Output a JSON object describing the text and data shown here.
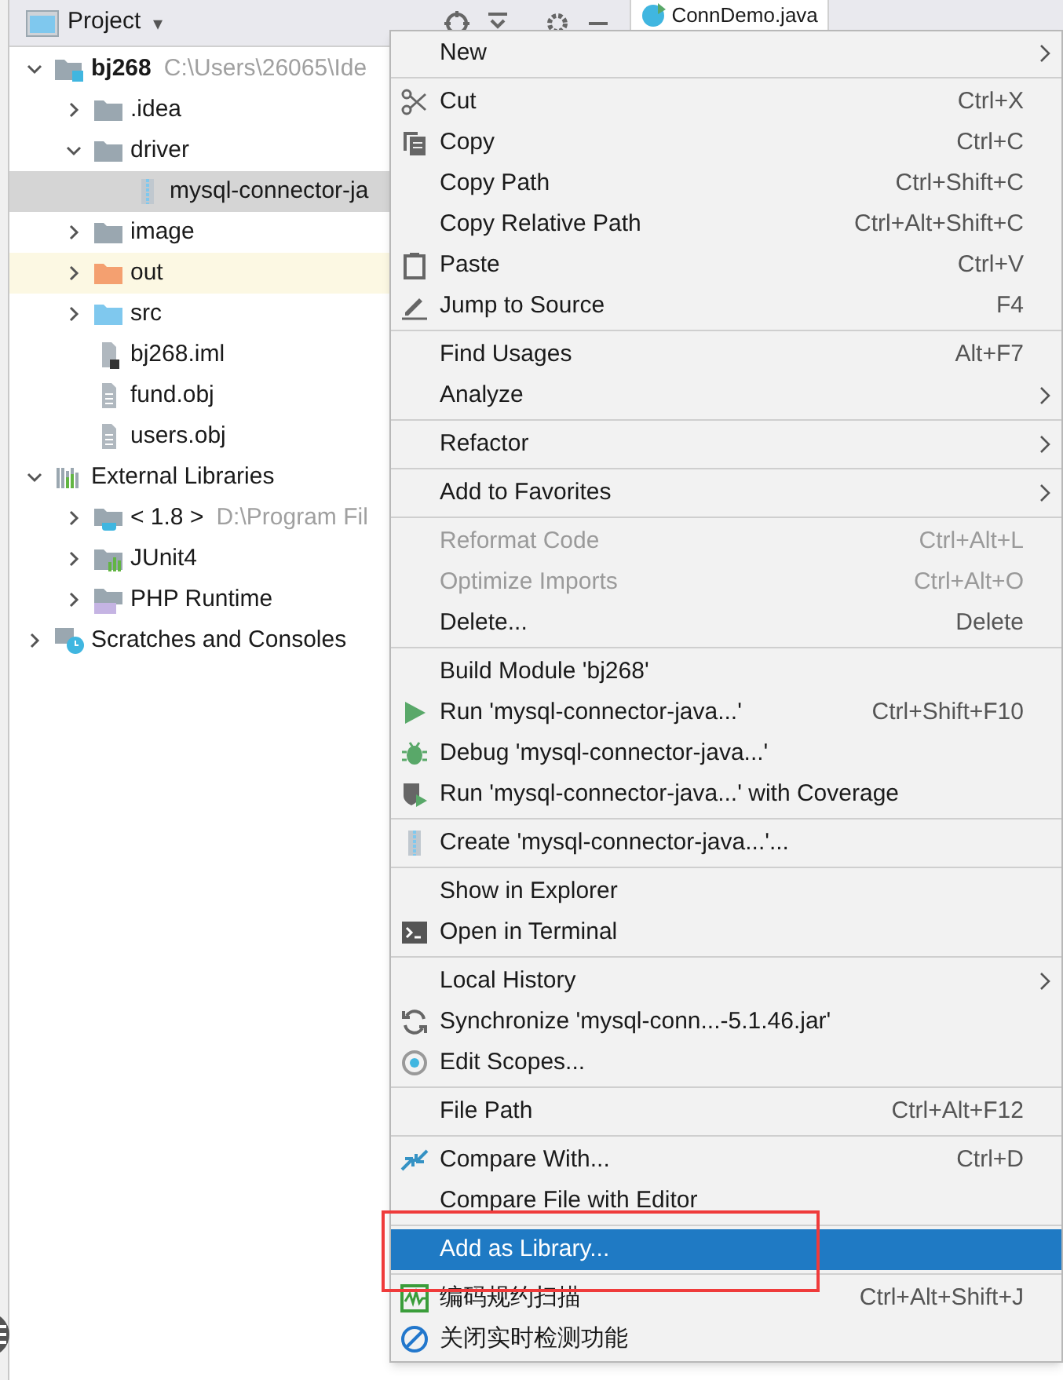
{
  "panel": {
    "title": "Project",
    "dropdown": "▾"
  },
  "editor_tab": {
    "label": "ConnDemo.java"
  },
  "tree": [
    {
      "label": "bj268",
      "detail": "C:\\Users\\26065\\Ide",
      "kind": "module",
      "expanded": true,
      "selected": false,
      "highlighted": false,
      "children": [
        {
          "label": ".idea",
          "kind": "folder",
          "expanded": false,
          "selected": false,
          "highlighted": false
        },
        {
          "label": "driver",
          "kind": "folder",
          "expanded": true,
          "selected": false,
          "highlighted": false,
          "children": [
            {
              "label": "mysql-connector-ja",
              "kind": "jar",
              "selected": true,
              "highlighted": false
            }
          ]
        },
        {
          "label": "image",
          "kind": "folder",
          "expanded": false,
          "selected": false,
          "highlighted": false
        },
        {
          "label": "out",
          "kind": "excluded",
          "expanded": false,
          "selected": false,
          "highlighted": true
        },
        {
          "label": "src",
          "kind": "source",
          "expanded": false,
          "selected": false,
          "highlighted": false
        },
        {
          "label": "bj268.iml",
          "kind": "iml",
          "selected": false,
          "highlighted": false
        },
        {
          "label": "fund.obj",
          "kind": "file",
          "selected": false,
          "highlighted": false
        },
        {
          "label": "users.obj",
          "kind": "file",
          "selected": false,
          "highlighted": false
        }
      ]
    },
    {
      "label": "External Libraries",
      "kind": "libraries",
      "expanded": true,
      "selected": false,
      "highlighted": false,
      "children": [
        {
          "label": "< 1.8 >",
          "detail": "D:\\Program Fil",
          "kind": "jdk",
          "expanded": false,
          "selected": false,
          "highlighted": false
        },
        {
          "label": "JUnit4",
          "kind": "library",
          "expanded": false,
          "selected": false,
          "highlighted": false
        },
        {
          "label": "PHP Runtime",
          "kind": "php",
          "expanded": false,
          "selected": false,
          "highlighted": false
        }
      ]
    },
    {
      "label": "Scratches and Consoles",
      "kind": "scratches",
      "expanded": false,
      "selected": false,
      "highlighted": false
    }
  ],
  "context_menu": [
    {
      "kind": "plain",
      "label": "New",
      "submenu": true,
      "disabled": false,
      "selected": false
    },
    {
      "kind": "separator"
    },
    {
      "kind": "cut",
      "label": "Cut",
      "shortcut": "Ctrl+X",
      "submenu": false,
      "disabled": false,
      "selected": false
    },
    {
      "kind": "copy",
      "label": "Copy",
      "shortcut": "Ctrl+C",
      "submenu": false,
      "disabled": false,
      "selected": false
    },
    {
      "kind": "plain",
      "label": "Copy Path",
      "shortcut": "Ctrl+Shift+C",
      "submenu": false,
      "disabled": false,
      "selected": false
    },
    {
      "kind": "plain",
      "label": "Copy Relative Path",
      "shortcut": "Ctrl+Alt+Shift+C",
      "submenu": false,
      "disabled": false,
      "selected": false
    },
    {
      "kind": "paste",
      "label": "Paste",
      "shortcut": "Ctrl+V",
      "submenu": false,
      "disabled": false,
      "selected": false
    },
    {
      "kind": "jump",
      "label": "Jump to Source",
      "shortcut": "F4",
      "submenu": false,
      "disabled": false,
      "selected": false
    },
    {
      "kind": "separator"
    },
    {
      "kind": "plain",
      "label": "Find Usages",
      "shortcut": "Alt+F7",
      "submenu": false,
      "disabled": false,
      "selected": false
    },
    {
      "kind": "plain",
      "label": "Analyze",
      "submenu": true,
      "disabled": false,
      "selected": false
    },
    {
      "kind": "separator"
    },
    {
      "kind": "plain",
      "label": "Refactor",
      "submenu": true,
      "disabled": false,
      "selected": false
    },
    {
      "kind": "separator"
    },
    {
      "kind": "plain",
      "label": "Add to Favorites",
      "submenu": true,
      "disabled": false,
      "selected": false
    },
    {
      "kind": "separator"
    },
    {
      "kind": "plain",
      "label": "Reformat Code",
      "shortcut": "Ctrl+Alt+L",
      "submenu": false,
      "disabled": true,
      "selected": false
    },
    {
      "kind": "plain",
      "label": "Optimize Imports",
      "shortcut": "Ctrl+Alt+O",
      "submenu": false,
      "disabled": true,
      "selected": false
    },
    {
      "kind": "plain",
      "label": "Delete...",
      "shortcut": "Delete",
      "submenu": false,
      "disabled": false,
      "selected": false
    },
    {
      "kind": "separator"
    },
    {
      "kind": "plain",
      "label": "Build Module 'bj268'",
      "submenu": false,
      "disabled": false,
      "selected": false
    },
    {
      "kind": "run",
      "label": "Run 'mysql-connector-java...'",
      "shortcut": "Ctrl+Shift+F10",
      "submenu": false,
      "disabled": false,
      "selected": false
    },
    {
      "kind": "debug",
      "label": "Debug 'mysql-connector-java...'",
      "submenu": false,
      "disabled": false,
      "selected": false
    },
    {
      "kind": "coverage",
      "label": "Run 'mysql-connector-java...' with Coverage",
      "submenu": false,
      "disabled": false,
      "selected": false
    },
    {
      "kind": "separator"
    },
    {
      "kind": "archive",
      "label": "Create 'mysql-connector-java...'...",
      "submenu": false,
      "disabled": false,
      "selected": false
    },
    {
      "kind": "separator"
    },
    {
      "kind": "plain",
      "label": "Show in Explorer",
      "submenu": false,
      "disabled": false,
      "selected": false
    },
    {
      "kind": "terminal",
      "label": "Open in Terminal",
      "submenu": false,
      "disabled": false,
      "selected": false
    },
    {
      "kind": "separator"
    },
    {
      "kind": "plain",
      "label": "Local History",
      "submenu": true,
      "disabled": false,
      "selected": false
    },
    {
      "kind": "sync",
      "label": "Synchronize 'mysql-conn...-5.1.46.jar'",
      "submenu": false,
      "disabled": false,
      "selected": false
    },
    {
      "kind": "scopes",
      "label": "Edit Scopes...",
      "submenu": false,
      "disabled": false,
      "selected": false
    },
    {
      "kind": "separator"
    },
    {
      "kind": "plain",
      "label": "File Path",
      "shortcut": "Ctrl+Alt+F12",
      "submenu": false,
      "disabled": false,
      "selected": false
    },
    {
      "kind": "separator"
    },
    {
      "kind": "compare",
      "label": "Compare With...",
      "shortcut": "Ctrl+D",
      "submenu": false,
      "disabled": false,
      "selected": false
    },
    {
      "kind": "plain",
      "label": "Compare File with Editor",
      "submenu": false,
      "disabled": false,
      "selected": false
    },
    {
      "kind": "separator"
    },
    {
      "kind": "plain",
      "label": "Add as Library...",
      "submenu": false,
      "disabled": false,
      "selected": true
    },
    {
      "kind": "separator"
    },
    {
      "kind": "scan",
      "label": "编码规约扫描",
      "shortcut": "Ctrl+Alt+Shift+J",
      "submenu": false,
      "disabled": false,
      "selected": false
    },
    {
      "kind": "ban",
      "label": "关闭实时检测功能",
      "submenu": false,
      "disabled": false,
      "selected": false
    }
  ]
}
